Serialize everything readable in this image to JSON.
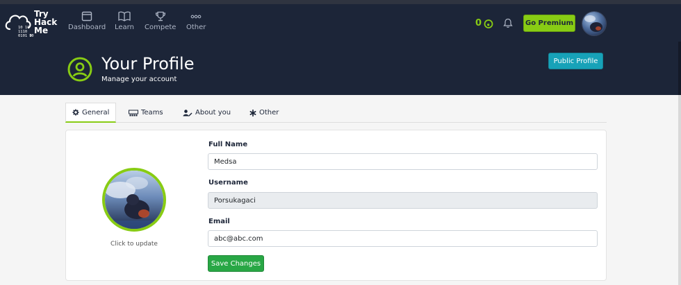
{
  "brand": {
    "line1": "Try",
    "line2": "Hack",
    "line3": "Me",
    "bits": [
      "10 10",
      "1110",
      "0101 0",
      "10"
    ]
  },
  "nav": {
    "items": [
      {
        "label": "Dashboard",
        "icon": "dashboard-icon"
      },
      {
        "label": "Learn",
        "icon": "book-icon"
      },
      {
        "label": "Compete",
        "icon": "trophy-icon"
      },
      {
        "label": "Other",
        "icon": "more-icon"
      }
    ],
    "streak": "0",
    "premium_label": "Go Premium"
  },
  "hero": {
    "title": "Your Profile",
    "subtitle": "Manage your account",
    "public_profile_label": "Public Profile"
  },
  "tabs": [
    {
      "label": "General",
      "icon": "gear-icon",
      "active": true
    },
    {
      "label": "Teams",
      "icon": "teams-icon",
      "active": false
    },
    {
      "label": "About you",
      "icon": "user-edit-icon",
      "active": false
    },
    {
      "label": "Other",
      "icon": "asterisk-icon",
      "active": false
    }
  ],
  "profile": {
    "click_to_update": "Click to update",
    "full_name_label": "Full Name",
    "full_name": "Medsa",
    "username_label": "Username",
    "username": "Porsukagaci",
    "email_label": "Email",
    "email": "abc@abc.com",
    "save_label": "Save Changes"
  },
  "colors": {
    "navy": "#1c2538",
    "accent_green": "#88cc14",
    "teal": "#17a2b8",
    "save_green": "#28a745"
  }
}
